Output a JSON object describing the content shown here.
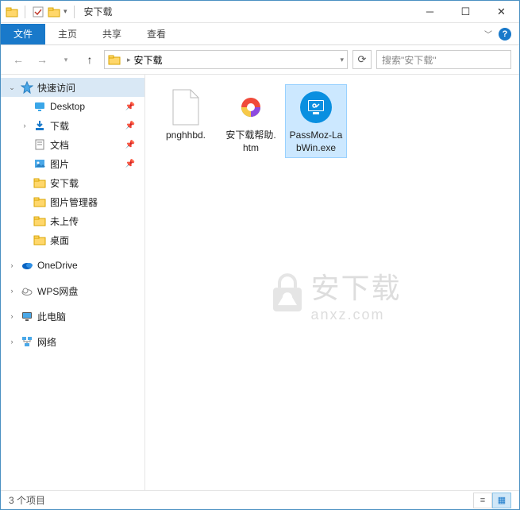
{
  "title": "安下载",
  "ribbon": {
    "file": "文件",
    "home": "主页",
    "share": "共享",
    "view": "查看"
  },
  "addr": {
    "crumb": "安下载",
    "dropdown_arrow": "▾"
  },
  "search": {
    "placeholder": "搜索\"安下载\""
  },
  "sidebar": {
    "quick_access": "快速访问",
    "items": [
      {
        "label": "Desktop",
        "pinned": true
      },
      {
        "label": "下载",
        "pinned": true
      },
      {
        "label": "文档",
        "pinned": true
      },
      {
        "label": "图片",
        "pinned": true
      },
      {
        "label": "安下载",
        "pinned": false
      },
      {
        "label": "图片管理器",
        "pinned": false
      },
      {
        "label": "未上传",
        "pinned": false
      },
      {
        "label": "桌面",
        "pinned": false
      }
    ],
    "onedrive": "OneDrive",
    "wps": "WPS网盘",
    "this_pc": "此电脑",
    "network": "网络"
  },
  "files": [
    {
      "name": "pnghhbd.",
      "type": "file"
    },
    {
      "name": "安下载帮助.htm",
      "type": "htm"
    },
    {
      "name": "PassMoz-LabWin.exe",
      "type": "exe",
      "selected": true
    }
  ],
  "status": {
    "text": "3 个项目"
  },
  "watermark": {
    "cn": "安下载",
    "en": "anxz.com"
  }
}
